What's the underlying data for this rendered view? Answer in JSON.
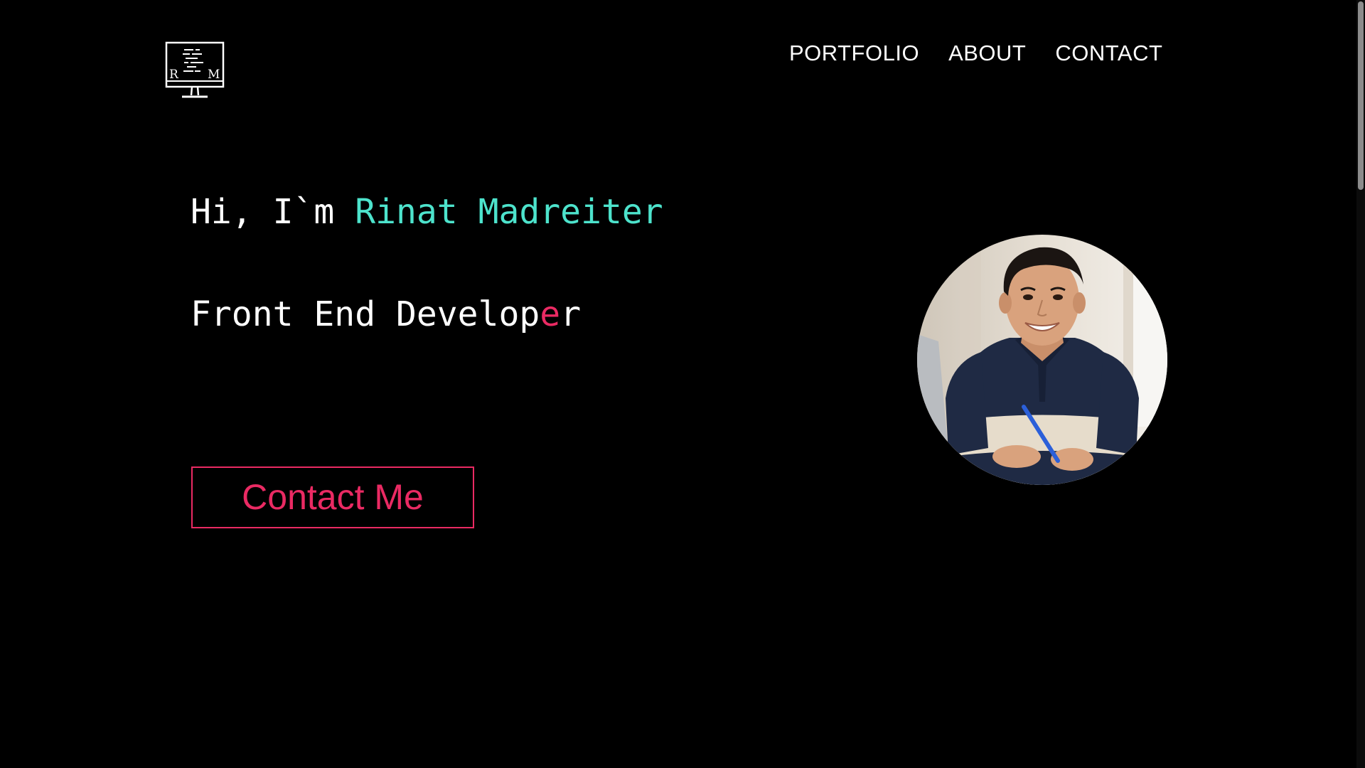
{
  "header": {
    "logo": {
      "icon": "monitor-code-icon",
      "initials_left": "R",
      "initials_right": "M"
    },
    "nav": [
      {
        "label": "PORTFOLIO"
      },
      {
        "label": "ABOUT"
      },
      {
        "label": "CONTACT"
      }
    ]
  },
  "hero": {
    "greeting_prefix": "Hi, I`m ",
    "name": "Rinat Madreiter",
    "role_prefix": "Front End Develop",
    "role_accent": "e",
    "role_suffix": "r",
    "cta_label": "Contact Me"
  },
  "colors": {
    "background": "#000000",
    "name_accent": "#4de3cc",
    "cta_accent": "#ea2a63",
    "text": "#ffffff"
  }
}
